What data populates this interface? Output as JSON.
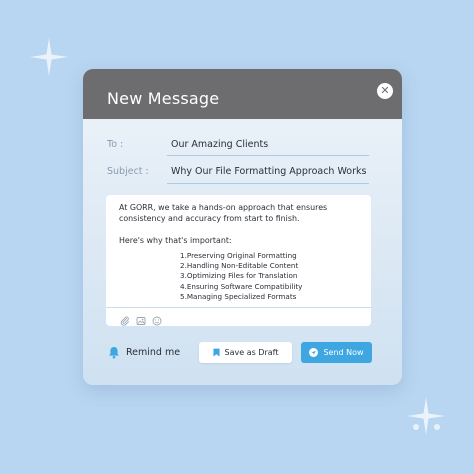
{
  "window": {
    "title": "New Message"
  },
  "fields": {
    "to_label": "To :",
    "to_value": "Our Amazing Clients",
    "subject_label": "Subject :",
    "subject_value": "Why Our File Formatting Approach Works"
  },
  "body": {
    "intro": "At GORR, we take a hands-on approach that ensures consistency and accuracy from start to finish.",
    "why": "Here's why that's important:",
    "list": [
      "1.Preserving Original Formatting",
      "2.Handling Non-Editable Content",
      "3.Optimizing Files for Translation",
      "4.Ensuring Software Compatibility",
      "5.Managing Specialized Formats"
    ]
  },
  "toolbar": {
    "icons": [
      "paperclip-icon",
      "image-icon",
      "emoji-icon"
    ]
  },
  "actions": {
    "remind_label": "Remind me",
    "save_draft_label": "Save as Draft",
    "send_label": "Send Now"
  },
  "colors": {
    "background": "#b8d6f1",
    "titlebar": "#6d6d70",
    "accent": "#3ea7e2"
  }
}
